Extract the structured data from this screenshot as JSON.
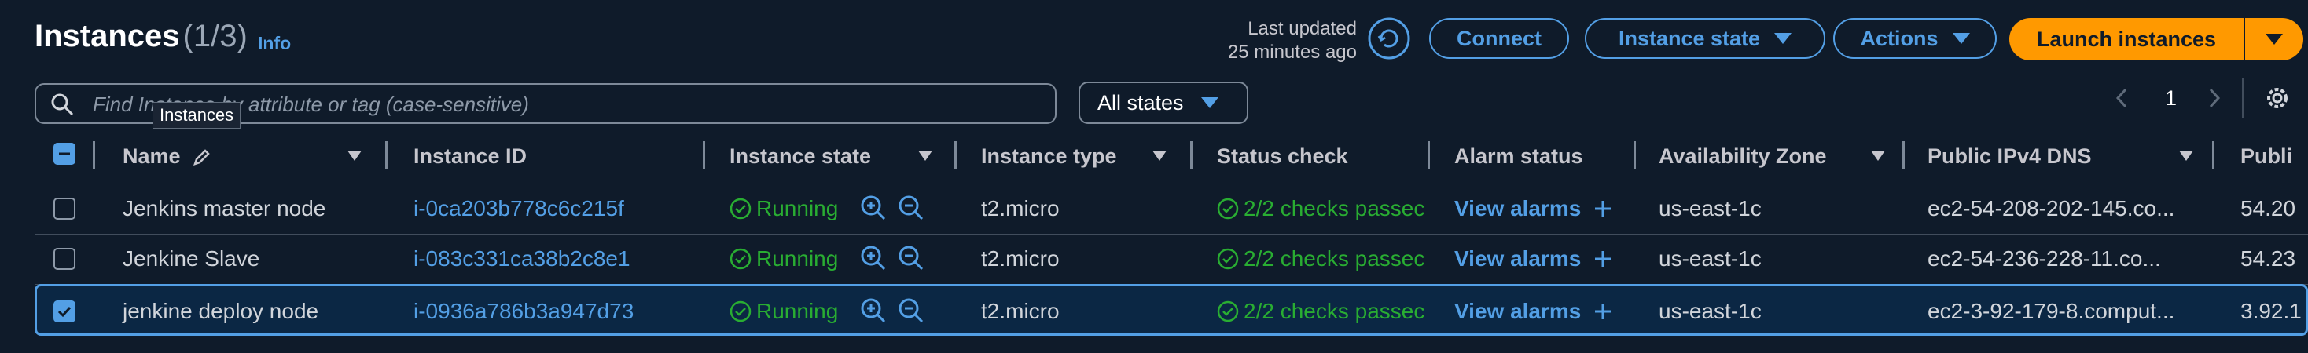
{
  "header": {
    "title": "Instances",
    "count": "(1/3)",
    "info": "Info",
    "last_updated_line1": "Last updated",
    "last_updated_line2": "25 minutes ago",
    "connect": "Connect",
    "instance_state": "Instance state",
    "actions": "Actions",
    "launch": "Launch instances"
  },
  "search": {
    "placeholder": "Find Instance by attribute or tag (case-sensitive)",
    "tooltip": "Instances"
  },
  "filter": {
    "states": "All states"
  },
  "pagination": {
    "page": "1"
  },
  "columns": {
    "name": "Name",
    "instance_id": "Instance ID",
    "instance_state": "Instance state",
    "instance_type": "Instance type",
    "status_check": "Status check",
    "alarm_status": "Alarm status",
    "availability_zone": "Availability Zone",
    "public_dns": "Public IPv4 DNS",
    "public_ip": "Publi"
  },
  "rows": [
    {
      "name": "Jenkins master node",
      "id": "i-0ca203b778c6c215f",
      "state": "Running",
      "type": "t2.micro",
      "status": "2/2 checks passec",
      "alarm": "View alarms",
      "az": "us-east-1c",
      "dns": "ec2-54-208-202-145.co...",
      "ip": "54.20",
      "selected": false
    },
    {
      "name": "Jenkine Slave",
      "id": "i-083c331ca38b2c8e1",
      "state": "Running",
      "type": "t2.micro",
      "status": "2/2 checks passec",
      "alarm": "View alarms",
      "az": "us-east-1c",
      "dns": "ec2-54-236-228-11.co...",
      "ip": "54.23",
      "selected": false
    },
    {
      "name": "jenkine deploy node",
      "id": "i-0936a786b3a947d73",
      "state": "Running",
      "type": "t2.micro",
      "status": "2/2 checks passec",
      "alarm": "View alarms",
      "az": "us-east-1c",
      "dns": "ec2-3-92-179-8.comput...",
      "ip": "3.92.1",
      "selected": true
    }
  ],
  "colors": {
    "accent": "#539fe5",
    "launch": "#ff9900",
    "running": "#29ad32",
    "background": "#0f1b2a"
  }
}
